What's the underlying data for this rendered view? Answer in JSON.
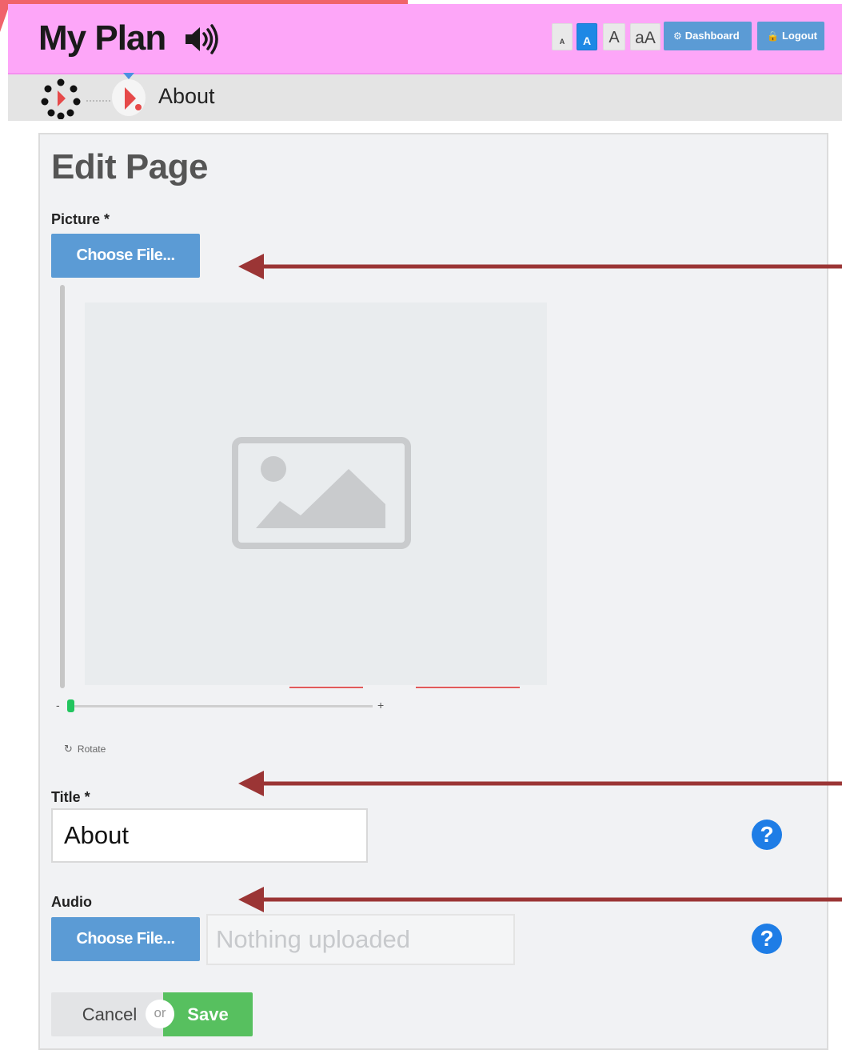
{
  "header": {
    "app_title": "My Plan",
    "font_size_buttons": [
      "A",
      "A",
      "A",
      "aA"
    ],
    "dashboard_label": "Dashboard",
    "logout_label": "Logout"
  },
  "breadcrumb": {
    "current_page": "About"
  },
  "form": {
    "heading": "Edit Page",
    "picture_label": "Picture *",
    "picture_button": "Choose File...",
    "zoom_minus": "-",
    "zoom_plus": "+",
    "zoom_level": 0,
    "rotate_label": "Rotate",
    "title_label": "Title *",
    "title_value": "About",
    "audio_label": "Audio",
    "audio_button": "Choose File...",
    "audio_status": "Nothing uploaded",
    "help_symbol": "?",
    "cancel_label": "Cancel",
    "or_label": "or",
    "save_label": "Save"
  },
  "colors": {
    "header_bg": "#fda6f8",
    "primary_button": "#5b9bd5",
    "save_button": "#57c05f",
    "annotation_arrow": "#9b3535"
  }
}
